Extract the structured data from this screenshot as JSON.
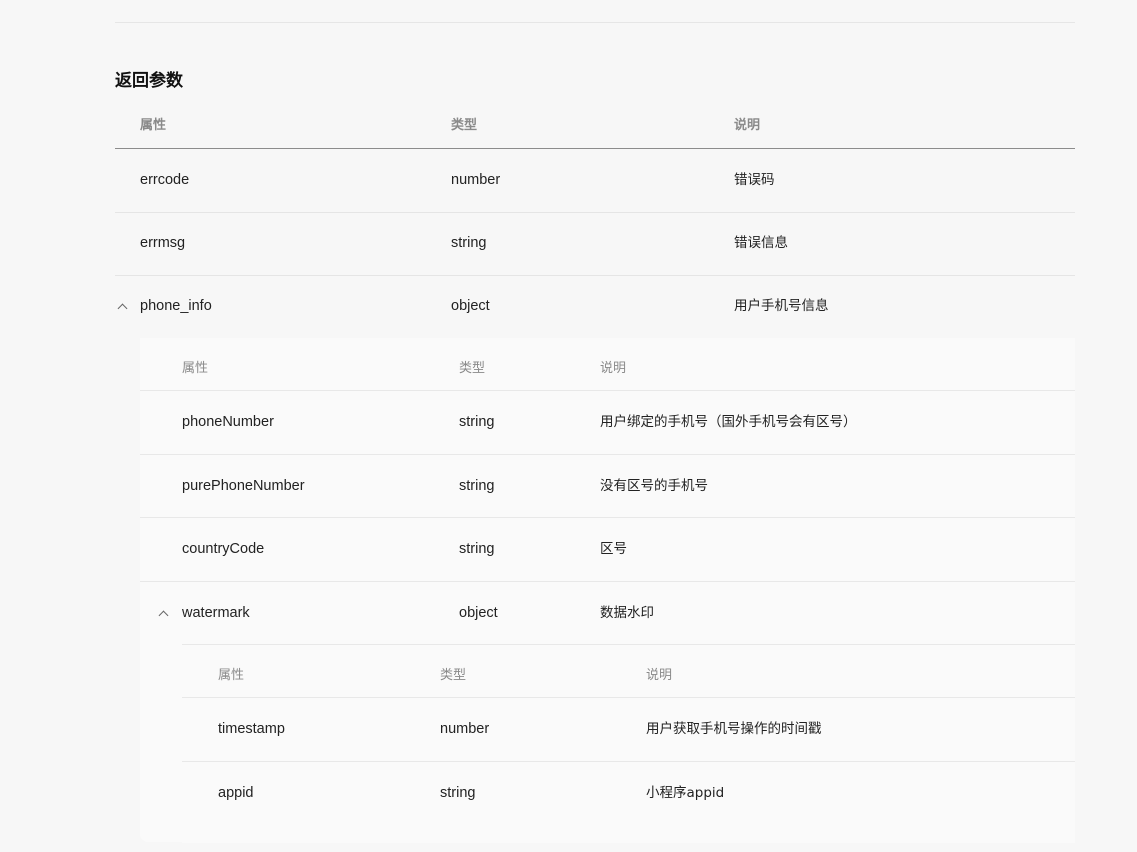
{
  "section": {
    "title": "返回参数"
  },
  "table": {
    "headers": {
      "name": "属性",
      "type": "类型",
      "desc": "说明"
    },
    "rows": [
      {
        "name": "errcode",
        "type": "number",
        "desc": "错误码"
      },
      {
        "name": "errmsg",
        "type": "string",
        "desc": "错误信息"
      },
      {
        "name": "phone_info",
        "type": "object",
        "desc": "用户手机号信息"
      }
    ]
  },
  "phone_info": {
    "headers": {
      "name": "属性",
      "type": "类型",
      "desc": "说明"
    },
    "rows": [
      {
        "name": "phoneNumber",
        "type": "string",
        "desc": "用户绑定的手机号（国外手机号会有区号）"
      },
      {
        "name": "purePhoneNumber",
        "type": "string",
        "desc": "没有区号的手机号"
      },
      {
        "name": "countryCode",
        "type": "string",
        "desc": "区号"
      },
      {
        "name": "watermark",
        "type": "object",
        "desc": "数据水印"
      }
    ]
  },
  "watermark": {
    "headers": {
      "name": "属性",
      "type": "类型",
      "desc": "说明"
    },
    "rows": [
      {
        "name": "timestamp",
        "type": "number",
        "desc": "用户获取手机号操作的时间戳"
      },
      {
        "name": "appid",
        "type": "string",
        "desc": "小程序appid"
      }
    ]
  }
}
